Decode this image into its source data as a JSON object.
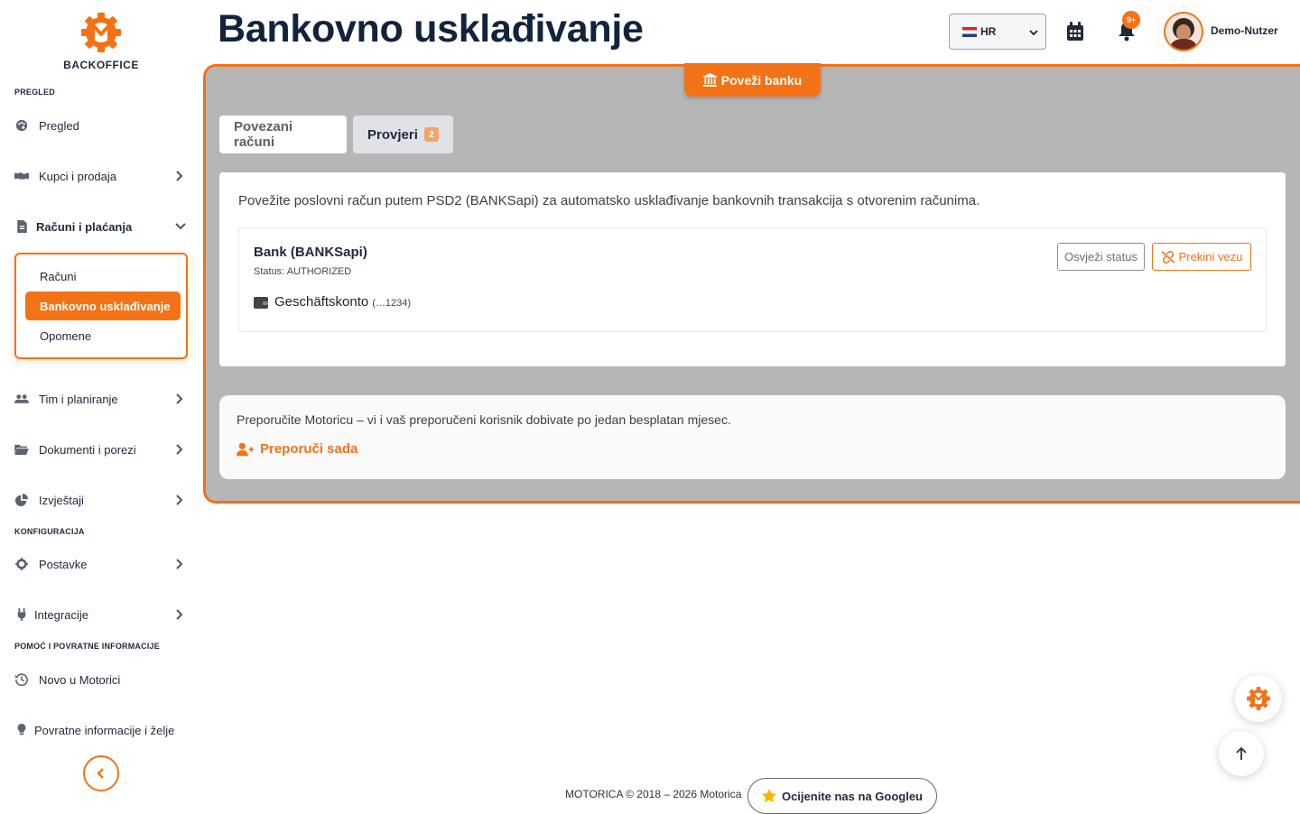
{
  "brand": {
    "name": "BACKOFFICE",
    "accent": "#f47216"
  },
  "sidebar": {
    "sections": {
      "overview": "PREGLED",
      "config": "KONFIGURACIJA",
      "help": "POMOĆ I POVRATNE INFORMACIJE"
    },
    "items": {
      "overview": {
        "label": "Pregled",
        "icon": "palette-icon"
      },
      "sales": {
        "label": "Kupci i prodaja",
        "icon": "handshake-icon"
      },
      "invoices": {
        "label": "Računi i plaćanja",
        "icon": "invoice-icon"
      },
      "team": {
        "label": "Tim i planiranje",
        "icon": "users-icon"
      },
      "docs": {
        "label": "Dokumenti i porezi",
        "icon": "folder-icon"
      },
      "reports": {
        "label": "Izvještaji",
        "icon": "chart-pie-icon"
      },
      "settings": {
        "label": "Postavke",
        "icon": "gear-icon"
      },
      "integrations": {
        "label": "Integracije",
        "icon": "plug-icon"
      },
      "news": {
        "label": "Novo u Motorici",
        "icon": "history-icon"
      },
      "feedback": {
        "label": "Povratne informacije i želje",
        "icon": "lightbulb-icon"
      }
    },
    "submenu": {
      "invoices": "Računi",
      "bank": "Bankovno usklađivanje",
      "reminders": "Opomene"
    }
  },
  "header": {
    "title": "Bankovno usklađivanje",
    "language": "HR",
    "notifications_badge": "9+",
    "user_name": "Demo-Nutzer"
  },
  "main": {
    "connect_button": "Poveži banku",
    "tabs": {
      "accounts": "Povezani računi",
      "checks": "Provjeri",
      "checks_count": "2"
    },
    "description": "Povežite poslovni račun putem PSD2 (BANKSapi) za automatsko usklađivanje bankovnih transakcija s otvorenim računima.",
    "bank": {
      "name": "Bank (BANKSapi)",
      "status": "Status: AUTHORIZED",
      "account_name": "Geschäftskonto",
      "account_number": "(…1234)",
      "refresh_label": "Osvježi status",
      "disconnect_label": "Prekini vezu"
    },
    "referral": {
      "text": "Preporučite Motoricu – vi i vaš preporučeni korisnik dobivate po jedan besplatan mjesec.",
      "link": "Preporuči sada"
    }
  },
  "footer": {
    "copyright": "MOTORICA © 2018 – 2026 Motorica",
    "rate_button": "Ocijenite nas na Googleu"
  }
}
